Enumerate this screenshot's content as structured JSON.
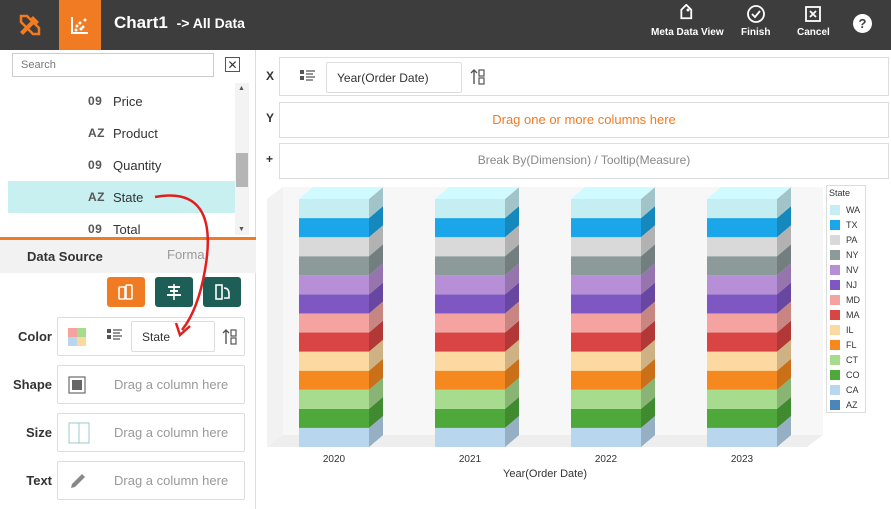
{
  "header": {
    "title": "Chart1",
    "subtitle": "-> All Data",
    "buttons": [
      {
        "label": "Meta Data View",
        "icon": "tag-icon"
      },
      {
        "label": "Finish",
        "icon": "check-circle-icon"
      },
      {
        "label": "Cancel",
        "icon": "close-box-icon"
      }
    ],
    "help": "?"
  },
  "sidebar": {
    "search_placeholder": "Search",
    "columns": [
      {
        "type": "09",
        "name": "Price"
      },
      {
        "type": "AZ",
        "name": "Product"
      },
      {
        "type": "09",
        "name": "Quantity"
      },
      {
        "type": "AZ",
        "name": "State"
      },
      {
        "type": "09",
        "name": "Total"
      }
    ],
    "tabs": {
      "active": "Data Source",
      "inactive": "Forma"
    },
    "mark_rows": {
      "color": {
        "label": "Color",
        "value": "State"
      },
      "shape": {
        "label": "Shape",
        "placeholder": "Drag a column here"
      },
      "size": {
        "label": "Size",
        "placeholder": "Drag a column here"
      },
      "text": {
        "label": "Text",
        "placeholder": "Drag a column here"
      }
    }
  },
  "shelves": {
    "x": {
      "label": "X",
      "value": "Year(Order Date)"
    },
    "y": {
      "label": "Y",
      "placeholder": "Drag one or more columns here"
    },
    "break": {
      "label": "+",
      "placeholder": "Break By(Dimension) / Tooltip(Measure)"
    }
  },
  "colors": {
    "accent": "#f07b22",
    "topbar": "#3d3d3d",
    "teal": "#1d5e57",
    "selected": "#c8f0f0"
  },
  "chart_data": {
    "type": "bar",
    "stacked": true,
    "xlabel": "Year(Order Date)",
    "categories": [
      "2020",
      "2021",
      "2022",
      "2023"
    ],
    "legend_title": "State",
    "series": [
      {
        "name": "WA",
        "color": "#c5eef3",
        "values": [
          1,
          1,
          1,
          1
        ]
      },
      {
        "name": "TX",
        "color": "#1aa6e8",
        "values": [
          1,
          1,
          1,
          1
        ]
      },
      {
        "name": "PA",
        "color": "#d9d9d9",
        "values": [
          1,
          1,
          1,
          1
        ]
      },
      {
        "name": "NY",
        "color": "#8c9a9a",
        "values": [
          1,
          1,
          1,
          1
        ]
      },
      {
        "name": "NV",
        "color": "#b78fd6",
        "values": [
          1,
          1,
          1,
          1
        ]
      },
      {
        "name": "NJ",
        "color": "#7e57c2",
        "values": [
          1,
          1,
          1,
          1
        ]
      },
      {
        "name": "MD",
        "color": "#f4a3a0",
        "values": [
          1,
          1,
          1,
          1
        ]
      },
      {
        "name": "MA",
        "color": "#d94444",
        "values": [
          1,
          1,
          1,
          1
        ]
      },
      {
        "name": "IL",
        "color": "#fbd9a0",
        "values": [
          1,
          1,
          1,
          1
        ]
      },
      {
        "name": "FL",
        "color": "#f5891f",
        "values": [
          1,
          1,
          1,
          1
        ]
      },
      {
        "name": "CT",
        "color": "#a7dc8e",
        "values": [
          1,
          1,
          1,
          1
        ]
      },
      {
        "name": "CO",
        "color": "#4ea83a",
        "values": [
          1,
          1,
          1,
          1
        ]
      },
      {
        "name": "CA",
        "color": "#b8d6ee",
        "values": [
          1,
          1,
          1,
          1
        ]
      },
      {
        "name": "AZ",
        "color": "#4a86b8",
        "values": [
          0,
          0,
          0,
          0
        ]
      }
    ],
    "legend_position": "right"
  }
}
